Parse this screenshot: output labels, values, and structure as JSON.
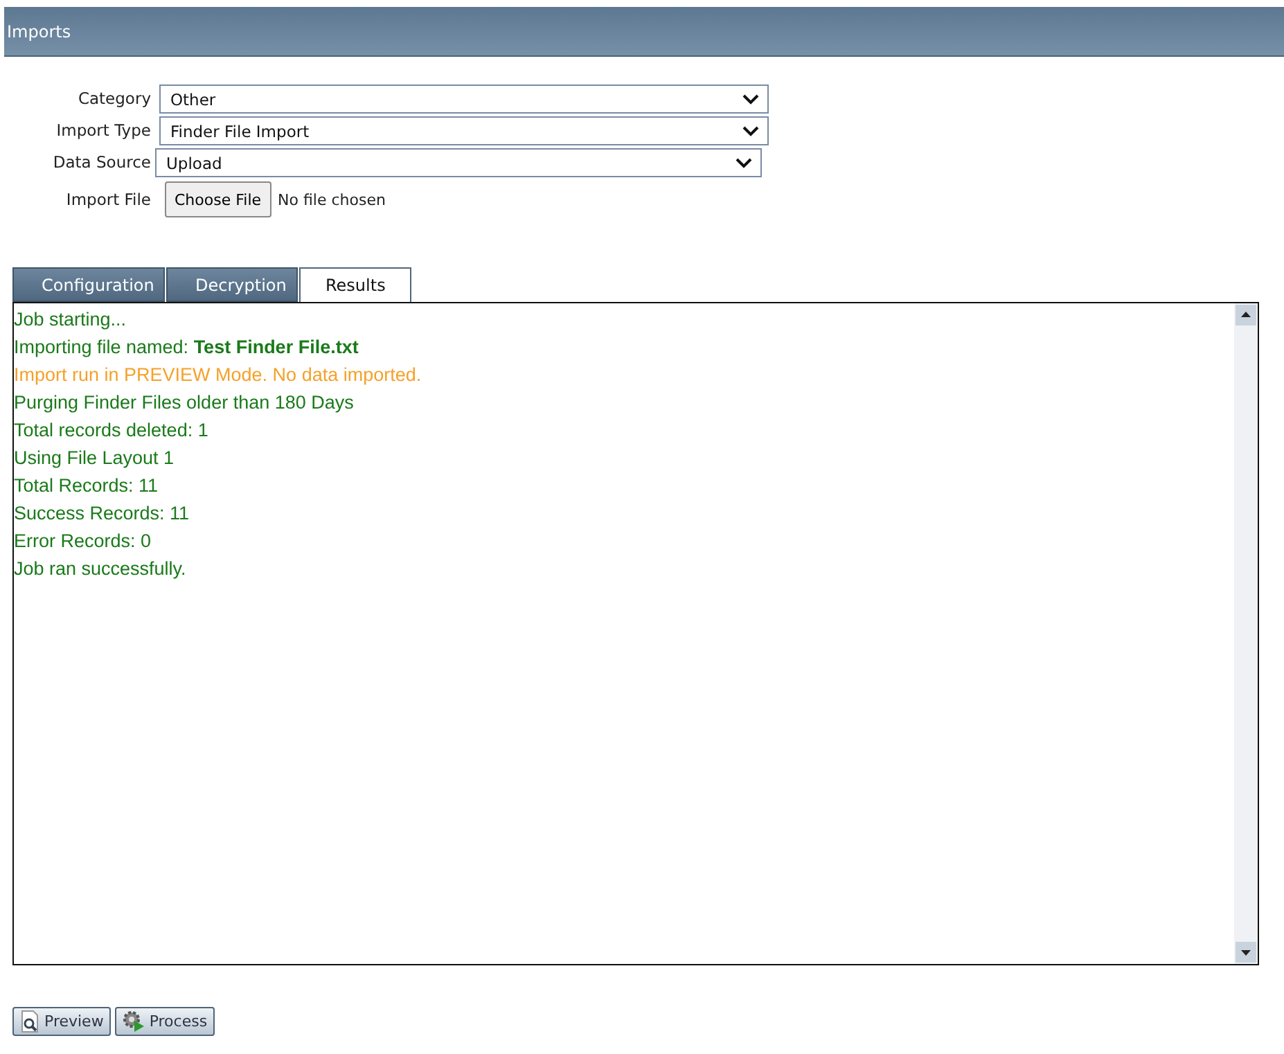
{
  "header": {
    "title": "Imports"
  },
  "form": [
    {
      "kind": "select",
      "label": "Category",
      "value": "Other"
    },
    {
      "kind": "select",
      "label": "Import Type",
      "value": "Finder File Import"
    },
    {
      "kind": "select",
      "label": "Data Source",
      "value": "Upload"
    },
    {
      "kind": "file",
      "label": "Import File",
      "button": "Choose File",
      "status": "No file chosen"
    }
  ],
  "tabs": [
    {
      "label": "Configuration",
      "selected": false
    },
    {
      "label": "Decryption",
      "selected": false
    },
    {
      "label": "Results",
      "selected": true
    }
  ],
  "log": [
    {
      "kind": "info",
      "text": "Job starting..."
    },
    {
      "kind": "info",
      "text": "Importing file named: **Test Finder File.txt**"
    },
    {
      "kind": "warning",
      "text": "Import run in PREVIEW Mode. No data imported."
    },
    {
      "kind": "info",
      "text": "Purging Finder Files older than 180 Days"
    },
    {
      "kind": "info",
      "text": "Total records deleted: 1"
    },
    {
      "kind": "info",
      "text": "Using File Layout 1"
    },
    {
      "kind": "info",
      "text": "Total Records: 11"
    },
    {
      "kind": "info",
      "text": "Success Records: 11"
    },
    {
      "kind": "info",
      "text": "Error Records: 0"
    },
    {
      "kind": "info",
      "text": "Job ran successfully."
    }
  ],
  "buttons": [
    {
      "kind": "preview",
      "label": "Preview"
    },
    {
      "kind": "process",
      "label": "Process"
    }
  ]
}
